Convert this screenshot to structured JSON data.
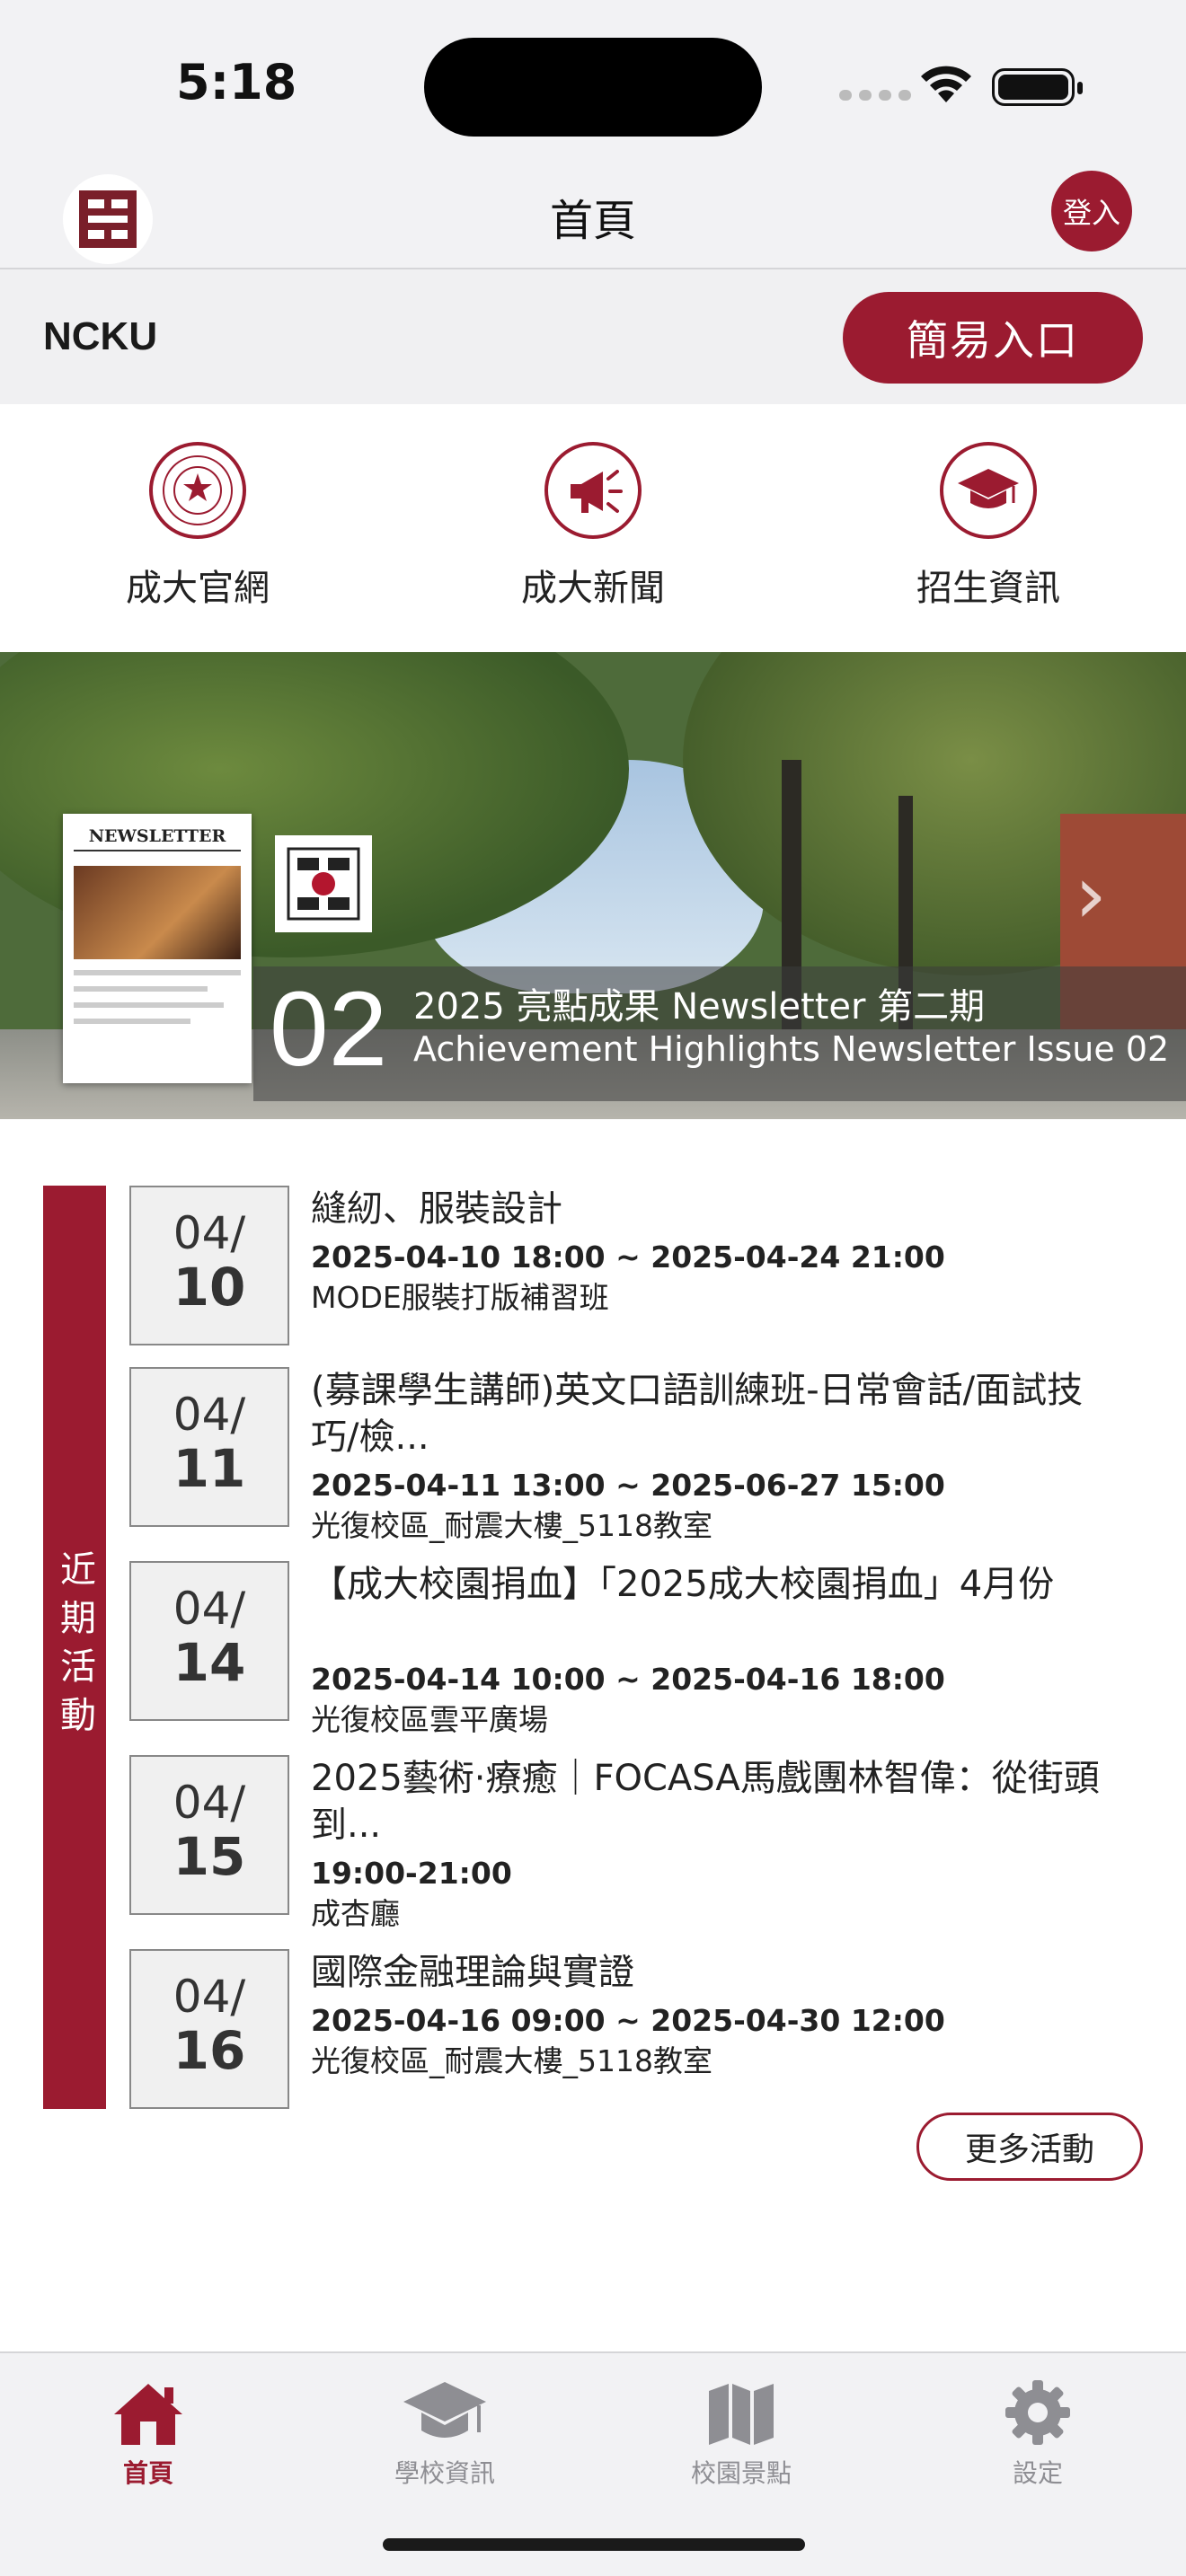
{
  "status_bar": {
    "time": "5:18"
  },
  "nav": {
    "title": "首頁",
    "login_label": "登入",
    "logo_icon": "ncku-logo-icon"
  },
  "ncku_bar": {
    "label": "NCKU",
    "quick_entry": "簡易入口"
  },
  "shortcuts": [
    {
      "label": "成大官網",
      "icon": "ncku-seal-icon"
    },
    {
      "label": "成大新聞",
      "icon": "megaphone-icon"
    },
    {
      "label": "招生資訊",
      "icon": "graduation-cap-icon"
    }
  ],
  "banner": {
    "newsletter_title": "NEWSLETTER",
    "issue_number": "02",
    "caption_zh": "2025 亮點成果 Newsletter 第二期",
    "caption_en": "Achievement Highlights Newsletter Issue 02"
  },
  "events_section": {
    "label": "近期活動",
    "more_label": "更多活動"
  },
  "events": [
    {
      "month": "04/",
      "day": "10",
      "title": "縫紉、服裝設計",
      "time": "2025-04-10 18:00 ~ 2025-04-24 21:00",
      "place": "MODE服裝打版補習班"
    },
    {
      "month": "04/",
      "day": "11",
      "title": "(募課學生講師)英文口語訓練班-日常會話/面試技巧/檢...",
      "time": "2025-04-11 13:00 ~ 2025-06-27 15:00",
      "place": "光復校區_耐震大樓_5118教室"
    },
    {
      "month": "04/",
      "day": "14",
      "title": "【成大校園捐血】「2025成大校園捐血」4月份",
      "time": "2025-04-14 10:00 ~ 2025-04-16 18:00",
      "place": "光復校區雲平廣場"
    },
    {
      "month": "04/",
      "day": "15",
      "title": "2025藝術·療癒｜FOCASA馬戲團林智偉：從街頭到...",
      "time": "19:00-21:00",
      "place": "成杏廳"
    },
    {
      "month": "04/",
      "day": "16",
      "title": "國際金融理論與實證",
      "time": "2025-04-16 09:00 ~ 2025-04-30 12:00",
      "place": "光復校區_耐震大樓_5118教室"
    }
  ],
  "tabbar": [
    {
      "label": "首頁",
      "icon": "home-icon",
      "active": true
    },
    {
      "label": "學校資訊",
      "icon": "graduation-cap-icon",
      "active": false
    },
    {
      "label": "校園景點",
      "icon": "map-icon",
      "active": false
    },
    {
      "label": "設定",
      "icon": "gear-icon",
      "active": false
    }
  ],
  "colors": {
    "accent": "#9b1b30",
    "inactive": "#8e8e93"
  }
}
